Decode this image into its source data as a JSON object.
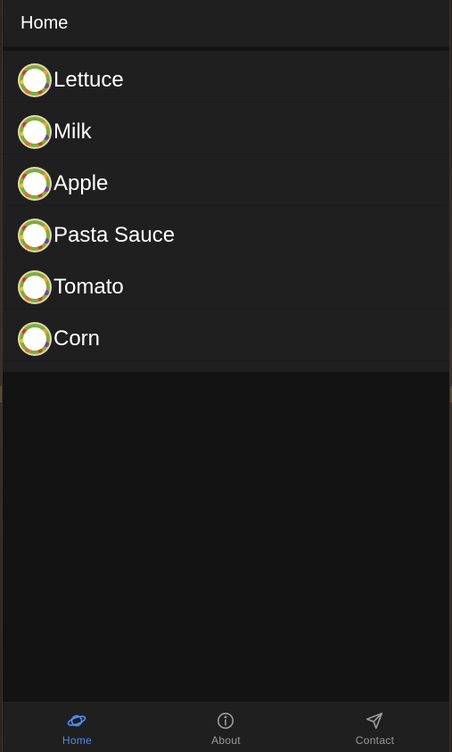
{
  "header": {
    "title": "Home"
  },
  "list": {
    "items": [
      {
        "label": "Lettuce",
        "icon": "vegetable-wreath-icon"
      },
      {
        "label": "Milk",
        "icon": "vegetable-wreath-icon"
      },
      {
        "label": "Apple",
        "icon": "vegetable-wreath-icon"
      },
      {
        "label": "Pasta Sauce",
        "icon": "vegetable-wreath-icon"
      },
      {
        "label": "Tomato",
        "icon": "vegetable-wreath-icon"
      },
      {
        "label": "Corn",
        "icon": "vegetable-wreath-icon"
      }
    ]
  },
  "tabs": [
    {
      "label": "Home",
      "icon": "planet-icon",
      "selected": true
    },
    {
      "label": "About",
      "icon": "info-circle-icon",
      "selected": false
    },
    {
      "label": "Contact",
      "icon": "send-icon",
      "selected": false
    }
  ],
  "colors": {
    "accent": "#4d8bf0",
    "header_bg": "#1f1f1f",
    "content_bg": "#131313",
    "inactive_tab": "#9a9a9a"
  }
}
